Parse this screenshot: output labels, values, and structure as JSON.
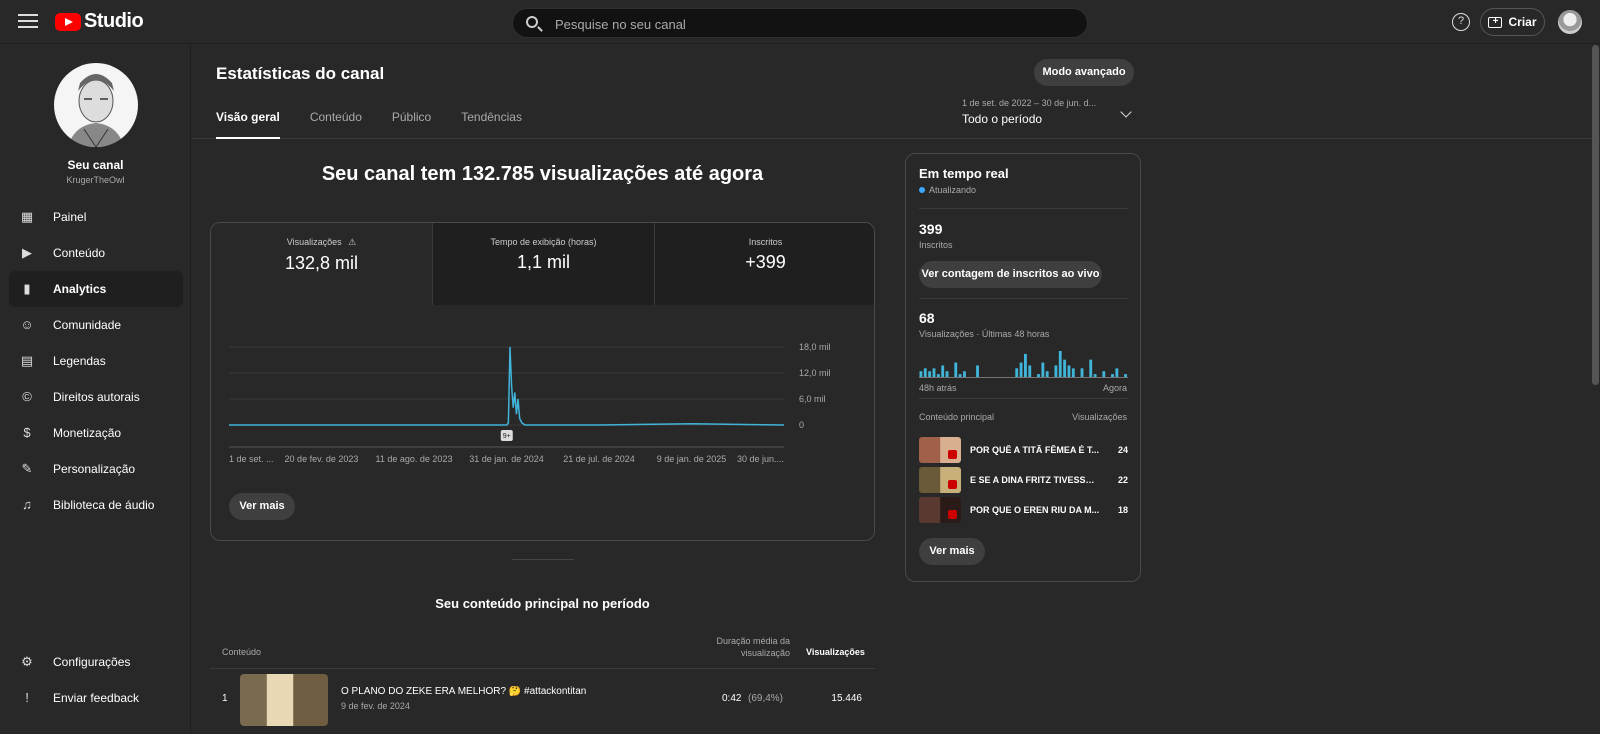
{
  "topbar": {
    "logo_text": "Studio",
    "search_placeholder": "Pesquise no seu canal",
    "create_label": "Criar",
    "help_glyph": "?"
  },
  "sidebar": {
    "channel_title": "Seu canal",
    "channel_handle": "KrugerTheOwl",
    "items": [
      {
        "label": "Painel",
        "icon": "dashboard-icon",
        "glyph": "▦"
      },
      {
        "label": "Conteúdo",
        "icon": "content-icon",
        "glyph": "▶"
      },
      {
        "label": "Analytics",
        "icon": "analytics-icon",
        "glyph": "▮",
        "active": true
      },
      {
        "label": "Comunidade",
        "icon": "community-icon",
        "glyph": "☺"
      },
      {
        "label": "Legendas",
        "icon": "subtitles-icon",
        "glyph": "▤"
      },
      {
        "label": "Direitos autorais",
        "icon": "copyright-icon",
        "glyph": "©"
      },
      {
        "label": "Monetização",
        "icon": "monetization-icon",
        "glyph": "$"
      },
      {
        "label": "Personalização",
        "icon": "customization-icon",
        "glyph": "✎"
      },
      {
        "label": "Biblioteca de áudio",
        "icon": "audio-library-icon",
        "glyph": "♫"
      }
    ],
    "bottom_items": [
      {
        "label": "Configurações",
        "icon": "settings-icon",
        "glyph": "⚙"
      },
      {
        "label": "Enviar feedback",
        "icon": "feedback-icon",
        "glyph": "!"
      }
    ]
  },
  "header": {
    "title": "Estatísticas do canal",
    "advanced_mode": "Modo avançado",
    "tabs": [
      "Visão geral",
      "Conteúdo",
      "Público",
      "Tendências"
    ],
    "date_range": "1 de set. de 2022 – 30 de jun. d...",
    "period": "Todo o período"
  },
  "overview": {
    "headline": "Seu canal tem 132.785 visualizações até agora",
    "metrics": [
      {
        "label": "Visualizações",
        "value": "132,8 mil"
      },
      {
        "label": "Tempo de exibição (horas)",
        "value": "1,1 mil"
      },
      {
        "label": "Inscritos",
        "value": "+399"
      }
    ],
    "see_more": "Ver mais",
    "warning_glyph": "⚠"
  },
  "chart_data": {
    "type": "line",
    "series": [
      {
        "x": [
          "2022-09-01",
          "2023-02-20",
          "2023-08-11",
          "2024-01-01",
          "2024-01-31",
          "2024-02-03",
          "2024-02-06",
          "2024-02-09",
          "2024-02-12",
          "2024-02-15",
          "2024-02-18",
          "2024-02-21",
          "2024-02-24",
          "2024-02-28",
          "2024-03-05",
          "2024-07-21",
          "2025-01-09",
          "2025-06-30"
        ],
        "y": [
          0,
          0,
          0,
          0,
          0,
          500,
          18000,
          9000,
          4000,
          7500,
          2500,
          6000,
          1500,
          500,
          0,
          0,
          300,
          0
        ]
      }
    ],
    "x_ticks": [
      "1 de set. ...",
      "20 de fev. de 2023",
      "11 de ago. de 2023",
      "31 de jan. de 2024",
      "21 de jul. de 2024",
      "9 de jan. de 2025",
      "30 de jun...."
    ],
    "y_ticks": [
      "18,0 mil",
      "12,0 mil",
      "6,0 mil",
      "0"
    ],
    "ylim": [
      0,
      18000
    ],
    "grid": true,
    "color": "#41b4d9",
    "marker_label": "9+"
  },
  "top_content": {
    "title": "Seu conteúdo principal no período",
    "col_content": "Conteúdo",
    "col_duration": "Duração média da visualização",
    "col_views": "Visualizações",
    "rows": [
      {
        "rank": "1",
        "title": "O PLANO DO ZEKE ERA MELHOR? 🤔 #attackontitan",
        "date": "9 de fev. de 2024",
        "duration": "0:42",
        "percent": "(69,4%)",
        "views": "15.446"
      }
    ]
  },
  "realtime": {
    "title": "Em tempo real",
    "status": "Atualizando",
    "subscribers_value": "399",
    "subscribers_label": "Inscritos",
    "live_count_button": "Ver contagem de inscritos ao vivo",
    "views_value": "68",
    "views_label": "Visualizações · Últimas 48 horas",
    "bars": [
      2,
      3,
      2,
      3,
      1,
      4,
      2,
      0,
      5,
      1,
      2,
      0,
      0,
      4,
      0,
      0,
      0,
      0,
      0,
      0,
      0,
      0,
      3,
      5,
      8,
      4,
      0,
      1,
      5,
      2,
      0,
      4,
      9,
      6,
      4,
      3,
      0,
      3,
      0,
      6,
      1,
      0,
      2,
      0,
      1,
      3,
      0,
      1
    ],
    "axis_start": "48h atrás",
    "axis_end": "Agora",
    "col_content": "Conteúdo principal",
    "col_views": "Visualizações",
    "items": [
      {
        "title": "POR QUÊ A TITÃ FÊMEA É T...",
        "views": "24"
      },
      {
        "title": "E SE A DINA FRITZ TIVESSE ...",
        "views": "22"
      },
      {
        "title": "POR QUE O EREN RIU DA M...",
        "views": "18"
      }
    ],
    "see_more": "Ver mais"
  }
}
